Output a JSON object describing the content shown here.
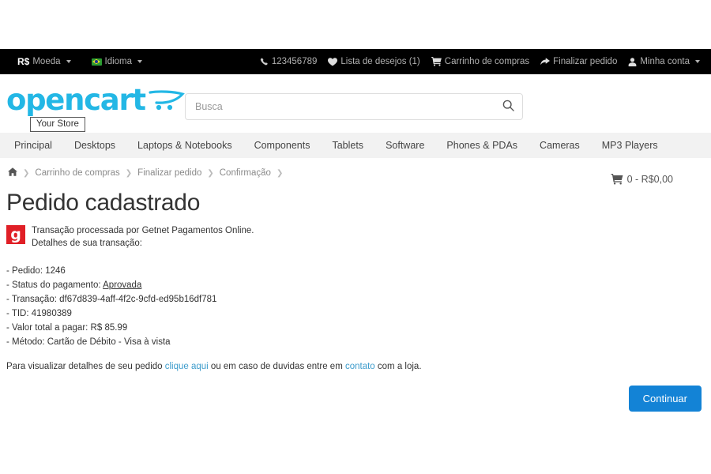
{
  "topbar": {
    "currency": {
      "symbol": "R$",
      "label": "Moeda"
    },
    "language": {
      "label": "Idioma"
    },
    "phone": "123456789",
    "wishlist": "Lista de desejos (1)",
    "cart_link": "Carrinho de compras",
    "checkout": "Finalizar pedido",
    "account": "Minha conta"
  },
  "header": {
    "logo_text": "opencart",
    "tooltip": "Your Store",
    "cart_total": "0 - R$0,00"
  },
  "search": {
    "placeholder": "Busca",
    "value": ""
  },
  "nav": {
    "items": [
      {
        "label": "Principal"
      },
      {
        "label": "Desktops"
      },
      {
        "label": "Laptops & Notebooks"
      },
      {
        "label": "Components"
      },
      {
        "label": "Tablets"
      },
      {
        "label": "Software"
      },
      {
        "label": "Phones & PDAs"
      },
      {
        "label": "Cameras"
      },
      {
        "label": "MP3 Players"
      }
    ]
  },
  "breadcrumb": {
    "items": [
      {
        "label": "Carrinho de compras"
      },
      {
        "label": "Finalizar pedido"
      },
      {
        "label": "Confirmação"
      }
    ]
  },
  "main": {
    "title": "Pedido cadastrado",
    "gateway_line1": "Transação processada por Getnet Pagamentos Online.",
    "gateway_line2": "Detalhes de sua transação:",
    "gateway_logo_letter": "g",
    "details": {
      "order_label": "- Pedido:",
      "order_value": "1246",
      "status_label": "- Status do pagamento:",
      "status_value": "Aprovada",
      "transaction_label": "- Transação:",
      "transaction_value": "df67d839-4aff-4f2c-9cfd-ed95b16df781",
      "tid_label": "- TID:",
      "tid_value": "41980389",
      "amount_label": "- Valor total a pagar:",
      "amount_value": "R$ 85.99",
      "method_label": "- Método:",
      "method_value": "Cartão de Débito - Visa à vista"
    },
    "help": {
      "before": "Para visualizar detalhes de seu pedido ",
      "link1": "clique aqui",
      "middle": " ou em caso de duvidas entre em ",
      "link2": "contato",
      "after": " com a loja."
    },
    "continue_button": "Continuar"
  },
  "colors": {
    "brand": "#23b7e5",
    "primary_button": "#1383d6",
    "gateway_red": "#e01f26",
    "link": "#3d9ccc",
    "topbar_bg": "#000000",
    "nav_bg": "#f2f2f2"
  }
}
